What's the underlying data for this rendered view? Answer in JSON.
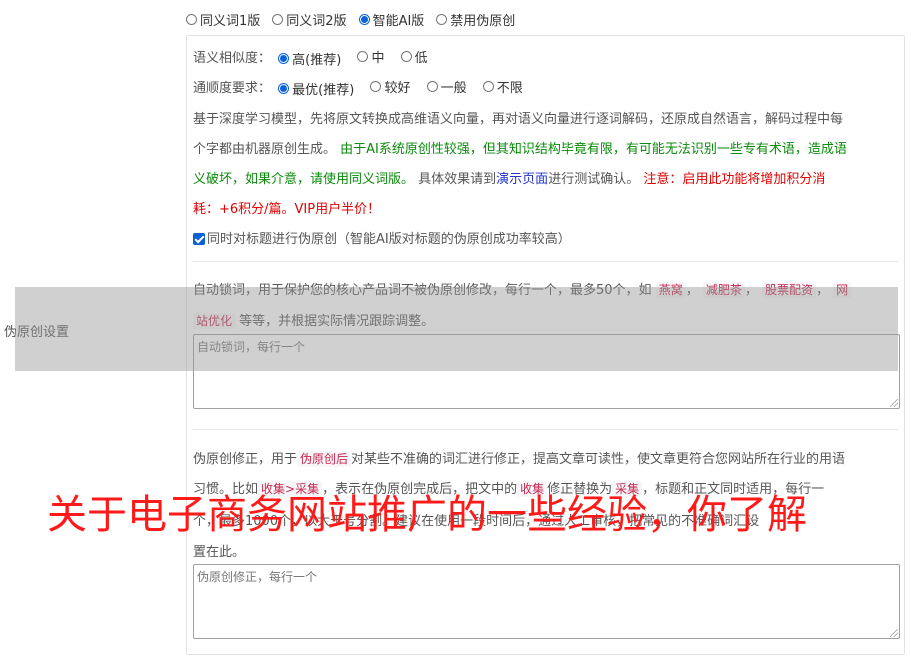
{
  "row_label": "伪原创设置",
  "mode_options": [
    {
      "label": "同义词1版",
      "selected": false
    },
    {
      "label": "同义词2版",
      "selected": false
    },
    {
      "label": "智能AI版",
      "selected": true
    },
    {
      "label": "禁用伪原创",
      "selected": false
    }
  ],
  "similarity": {
    "label": "语义相似度：",
    "options": [
      {
        "label": "高(推荐)",
        "selected": true
      },
      {
        "label": "中",
        "selected": false
      },
      {
        "label": "低",
        "selected": false
      }
    ]
  },
  "fluency": {
    "label": "通顺度要求：",
    "options": [
      {
        "label": "最优(推荐)",
        "selected": true
      },
      {
        "label": "较好",
        "selected": false
      },
      {
        "label": "一般",
        "selected": false
      },
      {
        "label": "不限",
        "selected": false
      }
    ]
  },
  "description": {
    "line1": "基于深度学习模型，先将原文转换成高维语义向量，再对语义向量进行逐词解码，还原成自然语言，解码过程中每",
    "line2_a": "个字都由机器原创生成。",
    "line2_green": "由于AI系统原创性较强，但其知识结构毕竟有限，有可能无法识别一些专有术语，造成语",
    "line3_green": "义破坏，如果介意，请使用同义词版。",
    "line3_a": "具体效果请到",
    "line3_link": "演示页面",
    "line3_b": "进行测试确认。",
    "line3_red": "注意：启用此功能将增加积分消",
    "line4_red": "耗：+6积分/篇。VIP用户半价！"
  },
  "title_checkbox": {
    "checked": true,
    "label": "同时对标题进行伪原创（智能AI版对标题的伪原创成功率较高）"
  },
  "lock_words": {
    "line1_a": "自动锁词，用于保护您的核心产品词不被伪原创修改，每行一个，最多50个，如",
    "examples": [
      "燕窝",
      "减肥茶",
      "股票配资",
      "网"
    ],
    "line2_code": "站优化",
    "line2_b": "等等，并根据实际情况跟踪调整。",
    "placeholder": "自动锁词，每行一个"
  },
  "correction": {
    "line1_a": "伪原创修正，用于",
    "line1_code": "伪原创后",
    "line1_b": "对某些不准确的词汇进行修正，提高文章可读性，使文章更符合您网站所在行业的用语",
    "line2_a": "习惯。比如",
    "line2_code1": "收集>采集",
    "line2_b": "，表示在伪原创完成后，把文中的",
    "line2_code2": "收集",
    "line2_c": "修正替换为",
    "line2_code3": "采集",
    "line2_d": "，标题和正文同时适用，每行一",
    "line3": "个，最多1000个，以大于号分割。建议在使用一段时间后，通过人工审核，把常见的不准确词汇设",
    "line4": "置在此。",
    "placeholder": "伪原创修正，每行一个"
  },
  "watermark": "关于电子商务网站推广的一些经验，你了解"
}
